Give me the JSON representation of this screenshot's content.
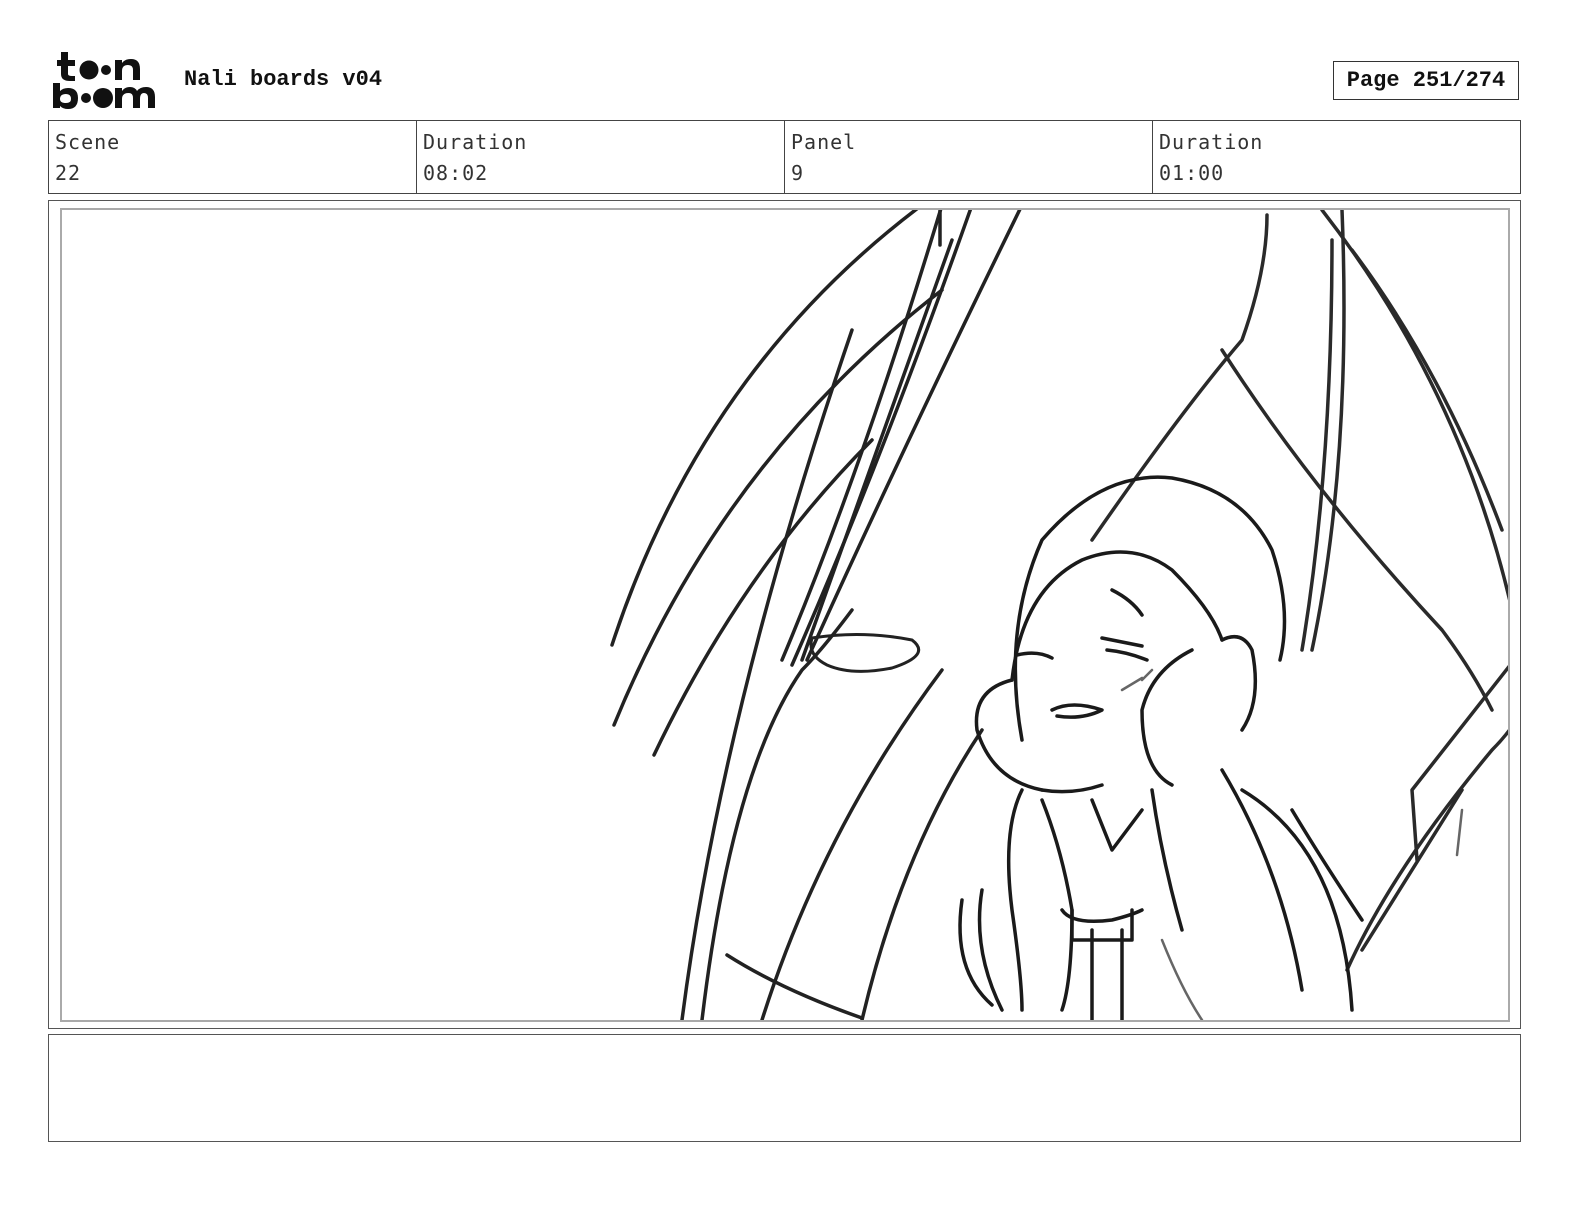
{
  "header": {
    "logo": {
      "line1": "toon",
      "line2": "boom"
    },
    "title": "Nali boards v04",
    "page": "Page 251/274"
  },
  "info": {
    "scene_label": "Scene",
    "scene_value": "22",
    "scene_duration_label": "Duration",
    "scene_duration_value": "08:02",
    "panel_label": "Panel",
    "panel_value": "9",
    "panel_duration_label": "Duration",
    "panel_duration_value": "01:00"
  },
  "panel": {
    "image": "storyboard-sketch"
  },
  "notes": {
    "text": ""
  }
}
